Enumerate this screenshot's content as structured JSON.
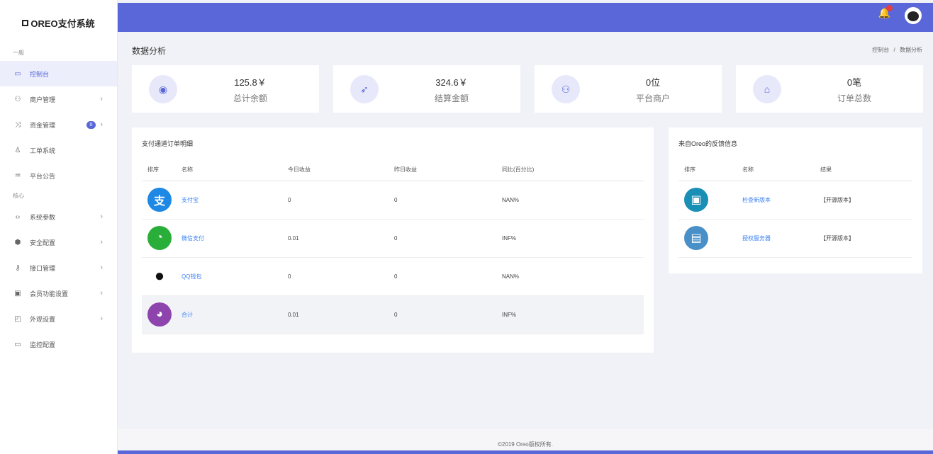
{
  "brand": {
    "name": "OREO支付系统"
  },
  "sidebar": {
    "section1": "一般",
    "section2": "核心",
    "items": [
      {
        "label": "控制台",
        "icon": "monitor-icon"
      },
      {
        "label": "商户管理",
        "icon": "users-icon"
      },
      {
        "label": "资金管理",
        "icon": "shuffle-icon",
        "badge": "0"
      },
      {
        "label": "工单系统",
        "icon": "user-add-icon"
      },
      {
        "label": "平台公告",
        "icon": "announce-icon"
      },
      {
        "label": "系统参数",
        "icon": "code-icon"
      },
      {
        "label": "安全配置",
        "icon": "shield-icon"
      },
      {
        "label": "接口管理",
        "icon": "key-icon"
      },
      {
        "label": "会员功能设置",
        "icon": "settings-box-icon"
      },
      {
        "label": "外观设置",
        "icon": "layout-icon"
      },
      {
        "label": "监控配置",
        "icon": "monitor-icon"
      }
    ]
  },
  "topbar": {
    "notification_count": "0"
  },
  "page": {
    "title": "数据分析",
    "breadcrumb_home": "控制台",
    "breadcrumb_sep": "/",
    "breadcrumb_current": "数据分析"
  },
  "stats": [
    {
      "value": "125.8￥",
      "label": "总计余额",
      "icon": "wallet-icon"
    },
    {
      "value": "324.6￥",
      "label": "结算金额",
      "icon": "rocket-icon"
    },
    {
      "value": "0位",
      "label": "平台商户",
      "icon": "users-icon"
    },
    {
      "value": "0笔",
      "label": "订单总数",
      "icon": "basket-icon"
    }
  ],
  "channels": {
    "title": "支付通道订单明细",
    "headers": [
      "排序",
      "名称",
      "今日收益",
      "昨日收益",
      "同比(百分比)"
    ],
    "rows": [
      {
        "name": "支付宝",
        "today": "0",
        "yesterday": "0",
        "ratio": "NAN%",
        "icon": "alipay-icon",
        "color": "#1e88e5",
        "glyph": "支"
      },
      {
        "name": "微信支付",
        "today": "0.01",
        "yesterday": "0",
        "ratio": "INF%",
        "icon": "wechat-icon",
        "color": "#2aae3a",
        "glyph": "◔"
      },
      {
        "name": "QQ钱包",
        "today": "0",
        "yesterday": "0",
        "ratio": "NAN%",
        "icon": "qq-icon",
        "color": "#111111",
        "glyph": "●"
      },
      {
        "name": "合计",
        "today": "0.01",
        "yesterday": "0",
        "ratio": "INF%",
        "icon": "pie-chart-icon",
        "color": "#8e44ad",
        "glyph": "◕"
      }
    ]
  },
  "feedback": {
    "title": "来自Oreo的反馈信息",
    "headers": [
      "排序",
      "名称",
      "结果"
    ],
    "rows": [
      {
        "name": "检查新版本",
        "result": "【开源版本】",
        "icon": "bottle-icon",
        "color": "#1a8fb5",
        "glyph": "▣"
      },
      {
        "name": "授权服务器",
        "result": "【开源版本】",
        "icon": "server-icon",
        "color": "#4a90c8",
        "glyph": "▤"
      }
    ]
  },
  "footer": {
    "text": "©2019 Oreo版权所有."
  }
}
